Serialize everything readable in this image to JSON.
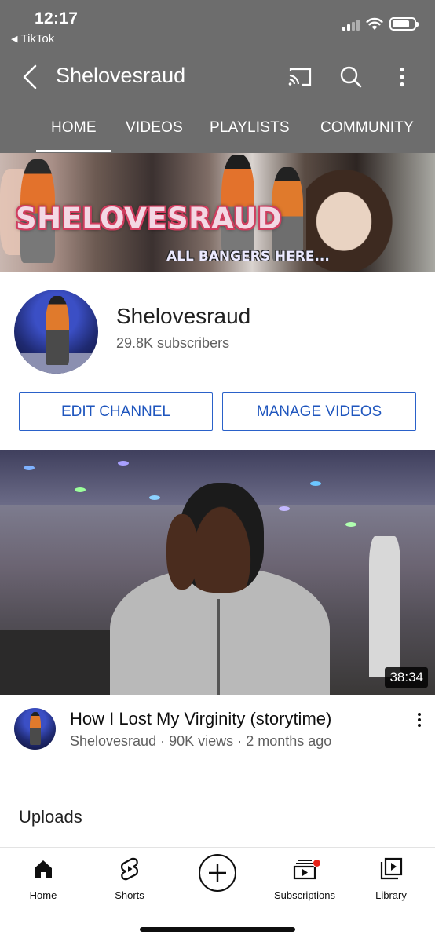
{
  "status_bar": {
    "time": "12:17",
    "back_app": "TikTok",
    "signal_bars_active": 2,
    "battery_level_fraction": 0.8
  },
  "app_bar": {
    "title": "Shelovesraud",
    "icons": [
      "back-arrow-icon",
      "cast-icon",
      "search-icon",
      "more-vert-icon"
    ]
  },
  "tabs": [
    {
      "label": "HOME",
      "selected": true
    },
    {
      "label": "VIDEOS",
      "selected": false
    },
    {
      "label": "PLAYLISTS",
      "selected": false
    },
    {
      "label": "COMMUNITY",
      "selected": false
    }
  ],
  "banner": {
    "title": "SHELOVESRAUD",
    "subtitle": "ALL BANGERS HERE..."
  },
  "channel": {
    "name": "Shelovesraud",
    "subscribers": "29.8K subscribers",
    "edit_button": "EDIT CHANNEL",
    "manage_button": "MANAGE VIDEOS"
  },
  "featured_video": {
    "duration": "38:34",
    "title": "How I Lost My Virginity (storytime)",
    "channel": "Shelovesraud",
    "views": "90K views",
    "age": "2 months ago",
    "separator": "·"
  },
  "sections": {
    "uploads": "Uploads"
  },
  "bottom_nav": [
    {
      "label": "Home",
      "icon": "home-icon",
      "selected": true
    },
    {
      "label": "Shorts",
      "icon": "shorts-icon",
      "selected": false
    },
    {
      "label": "",
      "icon": "create-plus-icon",
      "selected": false
    },
    {
      "label": "Subscriptions",
      "icon": "subscriptions-icon",
      "selected": false
    },
    {
      "label": "Library",
      "icon": "library-icon",
      "selected": false
    }
  ],
  "colors": {
    "header_bg": "#6d6d6d",
    "button_blue": "#2a61c9",
    "notification_dot": "#e62117"
  }
}
